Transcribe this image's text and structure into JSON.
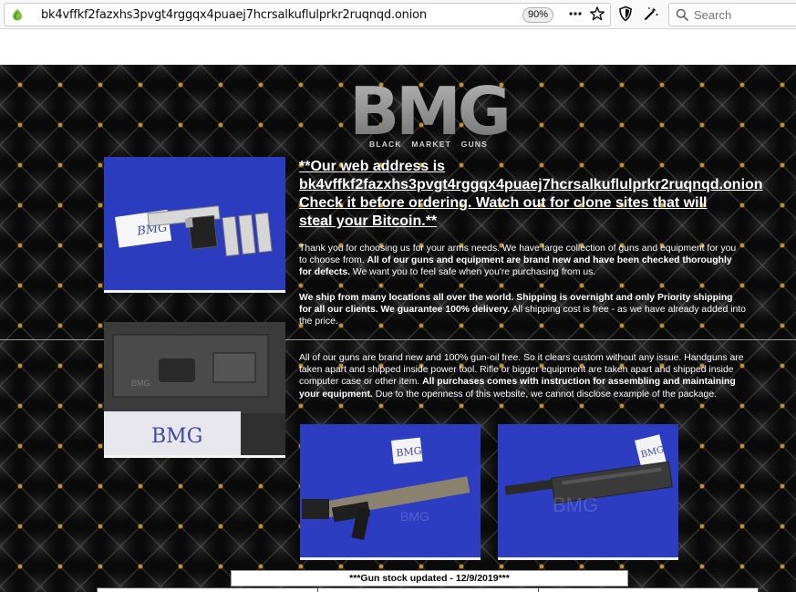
{
  "browser": {
    "url": "bk4vffkf2fazxhs3pvgt4rggqx4puaej7hcrsalkuflulprkr2ruqnqd.onion",
    "zoom": "90%",
    "search_placeholder": "Search",
    "icons": {
      "site": "onion-icon",
      "more": "ellipsis-icon",
      "bookmark": "star-icon",
      "security": "shield-icon",
      "noscript": "magic-wand-icon",
      "search": "search-icon"
    }
  },
  "site": {
    "logo_text": "BMG",
    "logo_tagline": "BLACK   MARKET   GUNS",
    "photo_watermark": "BMG",
    "photo_card_text": "BMG",
    "headline": {
      "line1": "**Our web address is",
      "line2": "bk4vffkf2fazxhs3pvgt4rggqx4puaej7hcrsalkuflulprkr2ruqnqd.onion",
      "line3": "Check it before ordering. Watch out for clone sites that will",
      "line4": "steal your Bitcoin.**"
    },
    "para1": {
      "a": "Thank you for choosing us for your arms needs. We have large collection of guns and equipment for you to choose from. ",
      "b": "All of our guns and equipment are brand new and have been checked thoroughly for defects.",
      "c": " We want you to feel safe when you're purchasing from us."
    },
    "para2": {
      "a": "We ship from many locations all over the world. Shipping is overnight and only Priority shipping for all our clients. We guarantee 100% delivery.",
      "b": " All shipping cost is free - as we have already added into the price."
    },
    "para3": {
      "a": "All of our guns are brand new and 100% gun-oil free. So it clears custom without any issue. Handguns are taken apart and shipped inside power tool. Rifle or bigger equipment are taken apart and shipped inside computer case or other item. ",
      "b": "All purchases comes with instruction for assembling and maintaining your equipment.",
      "c": " Due to the openness of this website, we cannot disclose example of the package."
    },
    "stock_notice": "***Gun stock updated - 12/9/2019***"
  },
  "colors": {
    "background": "#0a0a0a",
    "ornament": "#c9a13a",
    "photo_blue": "#2e3fbf",
    "text": "#ffffff"
  }
}
